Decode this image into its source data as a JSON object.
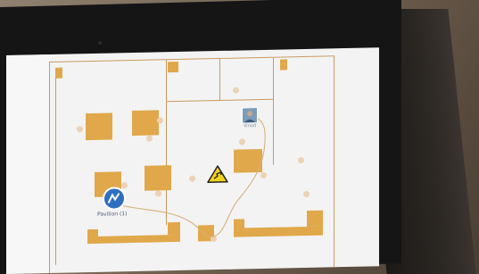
{
  "floorplan": {
    "marker_label": "Pavilion (1)",
    "user_label": "Vinod"
  },
  "icons": {
    "location": "pin-marker-icon",
    "user": "user-avatar-icon",
    "hazard": "warning-triangle-icon"
  },
  "colors": {
    "room_fill": "#e0a84a",
    "wall": "#c99a60",
    "marker_blue": "#2e6fbf",
    "hazard_yellow": "#f2d31a"
  }
}
